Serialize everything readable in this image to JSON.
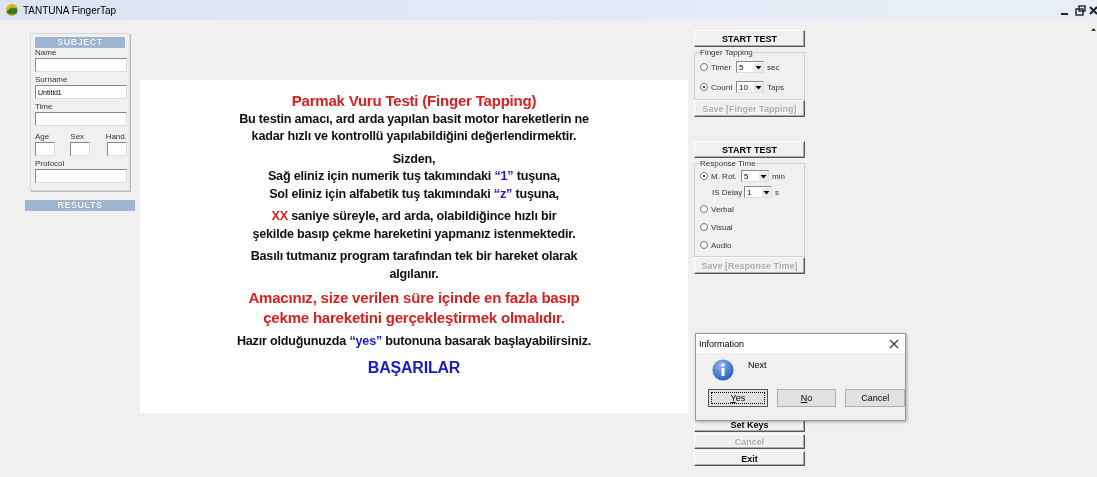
{
  "window": {
    "title": "TANTUNA FingerTap"
  },
  "subject": {
    "header": "SUBJECT",
    "fields": [
      {
        "kind": "wide",
        "label": "Name"
      },
      {
        "kind": "wide",
        "label": "Surname",
        "value": "Untitld1"
      },
      {
        "kind": "wide",
        "label": "Time"
      },
      {
        "kind": "triple",
        "items": [
          {
            "label": "Age"
          },
          {
            "label": "Sex"
          },
          {
            "label": "Hand."
          }
        ]
      },
      {
        "kind": "wide",
        "label": "Protocol"
      }
    ]
  },
  "results": {
    "header": "RESULTS"
  },
  "instructions": [
    {
      "kind": "title",
      "lines": [
        [
          {
            "text": "Parmak Vuru Testi (Finger Tapping)"
          }
        ]
      ]
    },
    {
      "kind": "body",
      "lines": [
        [
          {
            "text": "Bu testin amacı, ard arda yapılan basit motor hareketlerin ne"
          }
        ],
        [
          {
            "text": "kadar hızlı ve kontrollü yapılabildiğini değerlendirmektir."
          }
        ]
      ]
    },
    {
      "kind": "body",
      "lines": [
        [
          {
            "text": "Sizden,"
          }
        ],
        [
          {
            "text": "Sağ eliniz için numerik tuş takımındaki "
          },
          {
            "text": "“1”",
            "color": "#1a1acc"
          },
          {
            "text": " tuşuna,"
          }
        ],
        [
          {
            "text": "Sol eliniz için alfabetik tuş takımındaki "
          },
          {
            "text": "“z”",
            "color": "#1a1acc"
          },
          {
            "text": " tuşuna,"
          }
        ]
      ]
    },
    {
      "kind": "body",
      "lines": [
        [
          {
            "text": "XX",
            "color": "#e02020"
          },
          {
            "text": " saniye süreyle, ard arda, olabildiğince hızlı bir"
          }
        ],
        [
          {
            "text": "şekilde basıp çekme hareketini yapmanız istenmektedir."
          }
        ]
      ]
    },
    {
      "kind": "body",
      "lines": [
        [
          {
            "text": "Basılı tutmanız program tarafından tek bir hareket olarak"
          }
        ],
        [
          {
            "text": "algılanır."
          }
        ]
      ]
    },
    {
      "kind": "alert",
      "lines": [
        [
          {
            "text": "Amacınız, size verilen süre içinde en fazla basıp"
          }
        ],
        [
          {
            "text": "çekme hareketini gerçekleştirmek olmalıdır."
          }
        ]
      ]
    },
    {
      "kind": "body",
      "lines": [
        [
          {
            "text": "Hazır olduğunuzda "
          },
          {
            "text": "“yes”",
            "color": "#1a1acc"
          },
          {
            "text": " butonuna basarak başlayabilirsiniz."
          }
        ]
      ]
    },
    {
      "kind": "closing",
      "lines": [
        [
          {
            "text": "BAŞARILAR"
          }
        ]
      ]
    }
  ],
  "finger_tapping": {
    "start": "START TEST",
    "group": "Finger Tapping",
    "options": [
      {
        "label": "Timer",
        "checked": false,
        "value": "5",
        "unit": "sec"
      },
      {
        "label": "Count",
        "checked": true,
        "value": "10",
        "unit": "Taps"
      }
    ],
    "save": {
      "label": "Save [Finger Tapping]",
      "disabled": true
    }
  },
  "response_time": {
    "start": "START TEST",
    "group": "Response Time",
    "options": [
      {
        "kind": "select",
        "label": "M. Rot.",
        "checked": true,
        "value": "5",
        "unit": "min"
      },
      {
        "kind": "plain",
        "label": "IS Delay",
        "value": "1",
        "unit": "s"
      },
      {
        "kind": "radio",
        "label": "Verbal",
        "checked": false
      },
      {
        "kind": "radio",
        "label": "Visual",
        "checked": false
      },
      {
        "kind": "radio",
        "label": "Audio",
        "checked": false
      }
    ],
    "save": {
      "label": "Save [Response Time]",
      "disabled": true
    }
  },
  "bottom_buttons": [
    {
      "label": "Set Keys",
      "disabled": false
    },
    {
      "label": "Cancel",
      "disabled": true
    },
    {
      "label": "Exit",
      "disabled": false
    }
  ],
  "dialog": {
    "title": "Information",
    "message": "Next",
    "buttons": [
      {
        "label": "Yes",
        "focused": true,
        "underline_first": true
      },
      {
        "label": "No",
        "focused": false,
        "underline_first": true
      },
      {
        "label": "Cancel",
        "focused": false,
        "underline_first": false
      }
    ]
  }
}
